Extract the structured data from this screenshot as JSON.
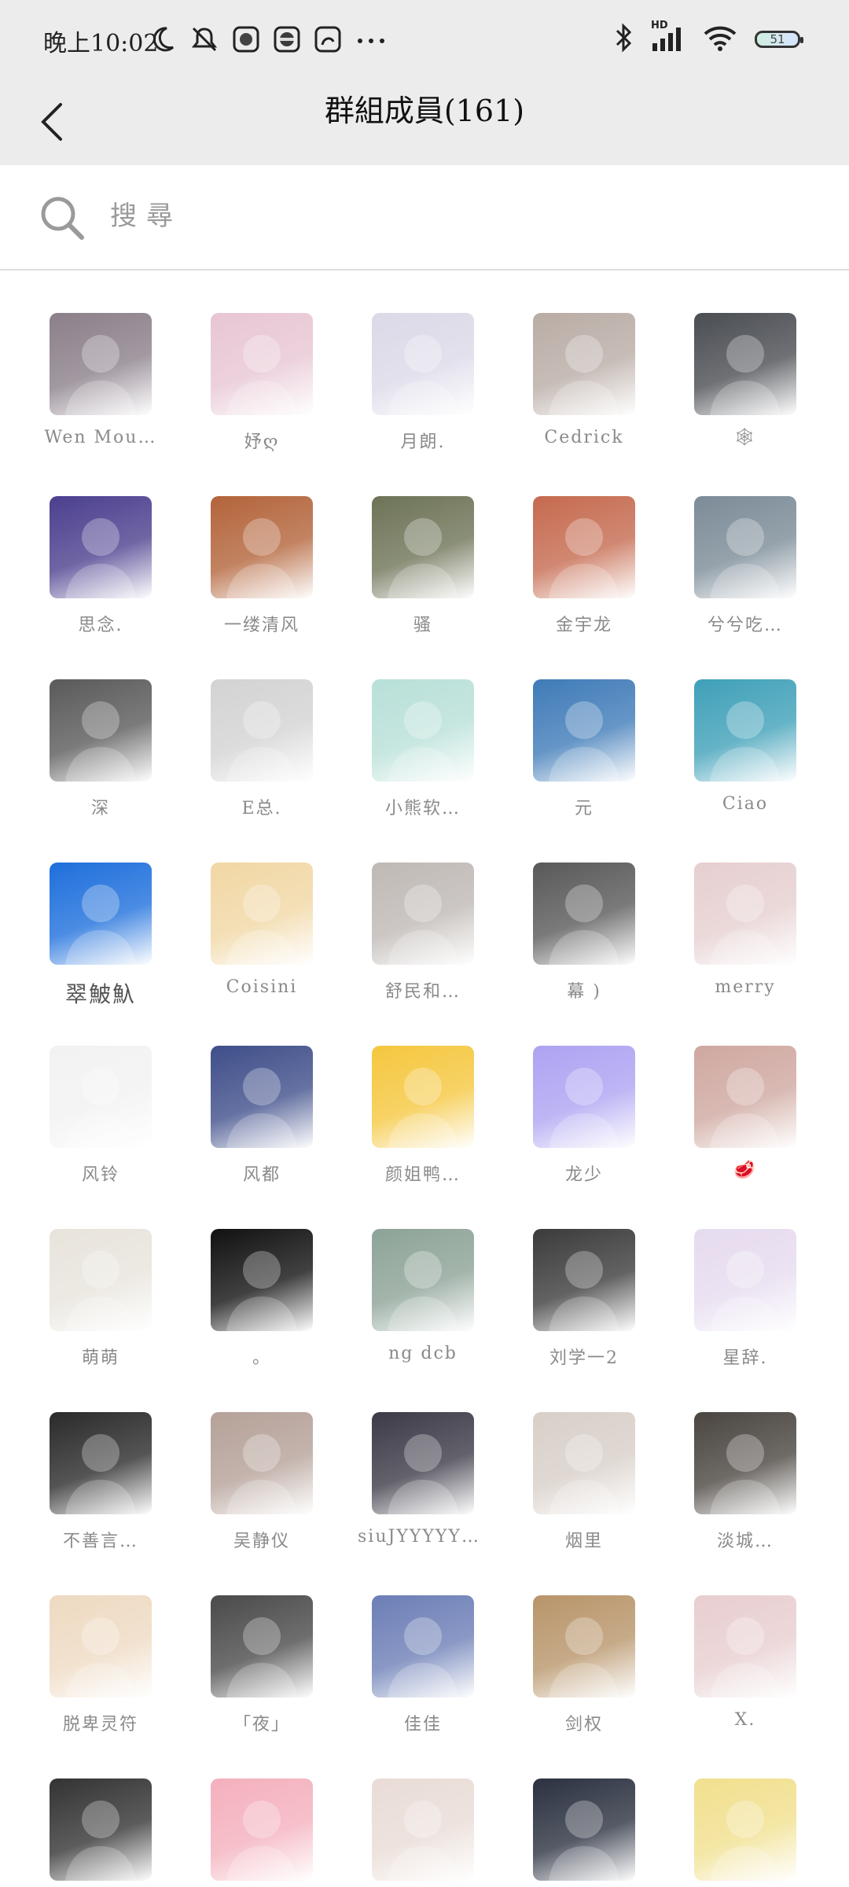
{
  "status_bar": {
    "time": "晚上10:02",
    "battery": "51",
    "network_label": "HD",
    "icons_left": [
      "moon-icon",
      "mute-icon",
      "app-icon",
      "app-icon",
      "app-icon",
      "more-icon"
    ],
    "icons_right": [
      "bluetooth-icon",
      "signal-icon",
      "wifi-icon",
      "battery-icon"
    ]
  },
  "header": {
    "title": "群組成員(161)"
  },
  "search": {
    "placeholder": "搜尋",
    "value": ""
  },
  "members": [
    {
      "name": "Wen Mou…",
      "avatar": "#8b7f8a"
    },
    {
      "name": "妤ღ",
      "avatar": "#e8c6d4"
    },
    {
      "name": "月朗.",
      "avatar": "#dcd9e8"
    },
    {
      "name": "Cedrick",
      "avatar": "#b9aca5"
    },
    {
      "name": "🕸",
      "avatar": "#4a4d52"
    },
    {
      "name": "思念.",
      "avatar": "#4b3f8e"
    },
    {
      "name": "一缕清风",
      "avatar": "#b3643a"
    },
    {
      "name": "骚",
      "avatar": "#6d7356"
    },
    {
      "name": "金宇龙",
      "avatar": "#c56a4f"
    },
    {
      "name": "兮兮吃…",
      "avatar": "#7b8b97"
    },
    {
      "name": "深",
      "avatar": "#5a5a5a"
    },
    {
      "name": "E总.",
      "avatar": "#d3d3d3"
    },
    {
      "name": "小熊软…",
      "avatar": "#b8e0d8"
    },
    {
      "name": "元",
      "avatar": "#3f7bb8"
    },
    {
      "name": "Ciao",
      "avatar": "#3fa0b8"
    },
    {
      "name": "翠鮍魞",
      "avatar": "#1e6fdc",
      "dark": true
    },
    {
      "name": "Coisini",
      "avatar": "#f1d7a4"
    },
    {
      "name": "舒民和…",
      "avatar": "#bfb9b5"
    },
    {
      "name": "幕 )",
      "avatar": "#595959"
    },
    {
      "name": "merry",
      "avatar": "#e6cfd0"
    },
    {
      "name": "风铃",
      "avatar": "#f2f2f2"
    },
    {
      "name": "风都",
      "avatar": "#3f4e8a"
    },
    {
      "name": "颜姐鸭…",
      "avatar": "#f5c73f"
    },
    {
      "name": "龙少",
      "avatar": "#ada3f2"
    },
    {
      "name": "🥩",
      "avatar": "#cfa8a0"
    },
    {
      "name": "萌萌",
      "avatar": "#e8e4dc"
    },
    {
      "name": "。",
      "avatar": "#111111"
    },
    {
      "name": "ng dcb",
      "avatar": "#8da397"
    },
    {
      "name": "刘学一2",
      "avatar": "#3b3b3b"
    },
    {
      "name": "星辞.",
      "avatar": "#e6dbef"
    },
    {
      "name": "不善言…",
      "avatar": "#2a2a2a"
    },
    {
      "name": "吴静仪",
      "avatar": "#b5a198"
    },
    {
      "name": "siuJYYYYYY~",
      "avatar": "#3c3a47"
    },
    {
      "name": "烟里",
      "avatar": "#d8cfc8"
    },
    {
      "name": "淡城…",
      "avatar": "#4a4540"
    },
    {
      "name": "脱卑灵符",
      "avatar": "#eedac2"
    },
    {
      "name": "「夜」",
      "avatar": "#4a4a4a"
    },
    {
      "name": "佳佳",
      "avatar": "#6c7eb6"
    },
    {
      "name": "剑权",
      "avatar": "#b8956a"
    },
    {
      "name": "X.",
      "avatar": "#e8ced0"
    },
    {
      "name": "",
      "avatar": "#333333"
    },
    {
      "name": "",
      "avatar": "#f4b0bd"
    },
    {
      "name": "",
      "avatar": "#e9dcd6"
    },
    {
      "name": "",
      "avatar": "#2b3140"
    },
    {
      "name": "",
      "avatar": "#f1e08e"
    }
  ]
}
